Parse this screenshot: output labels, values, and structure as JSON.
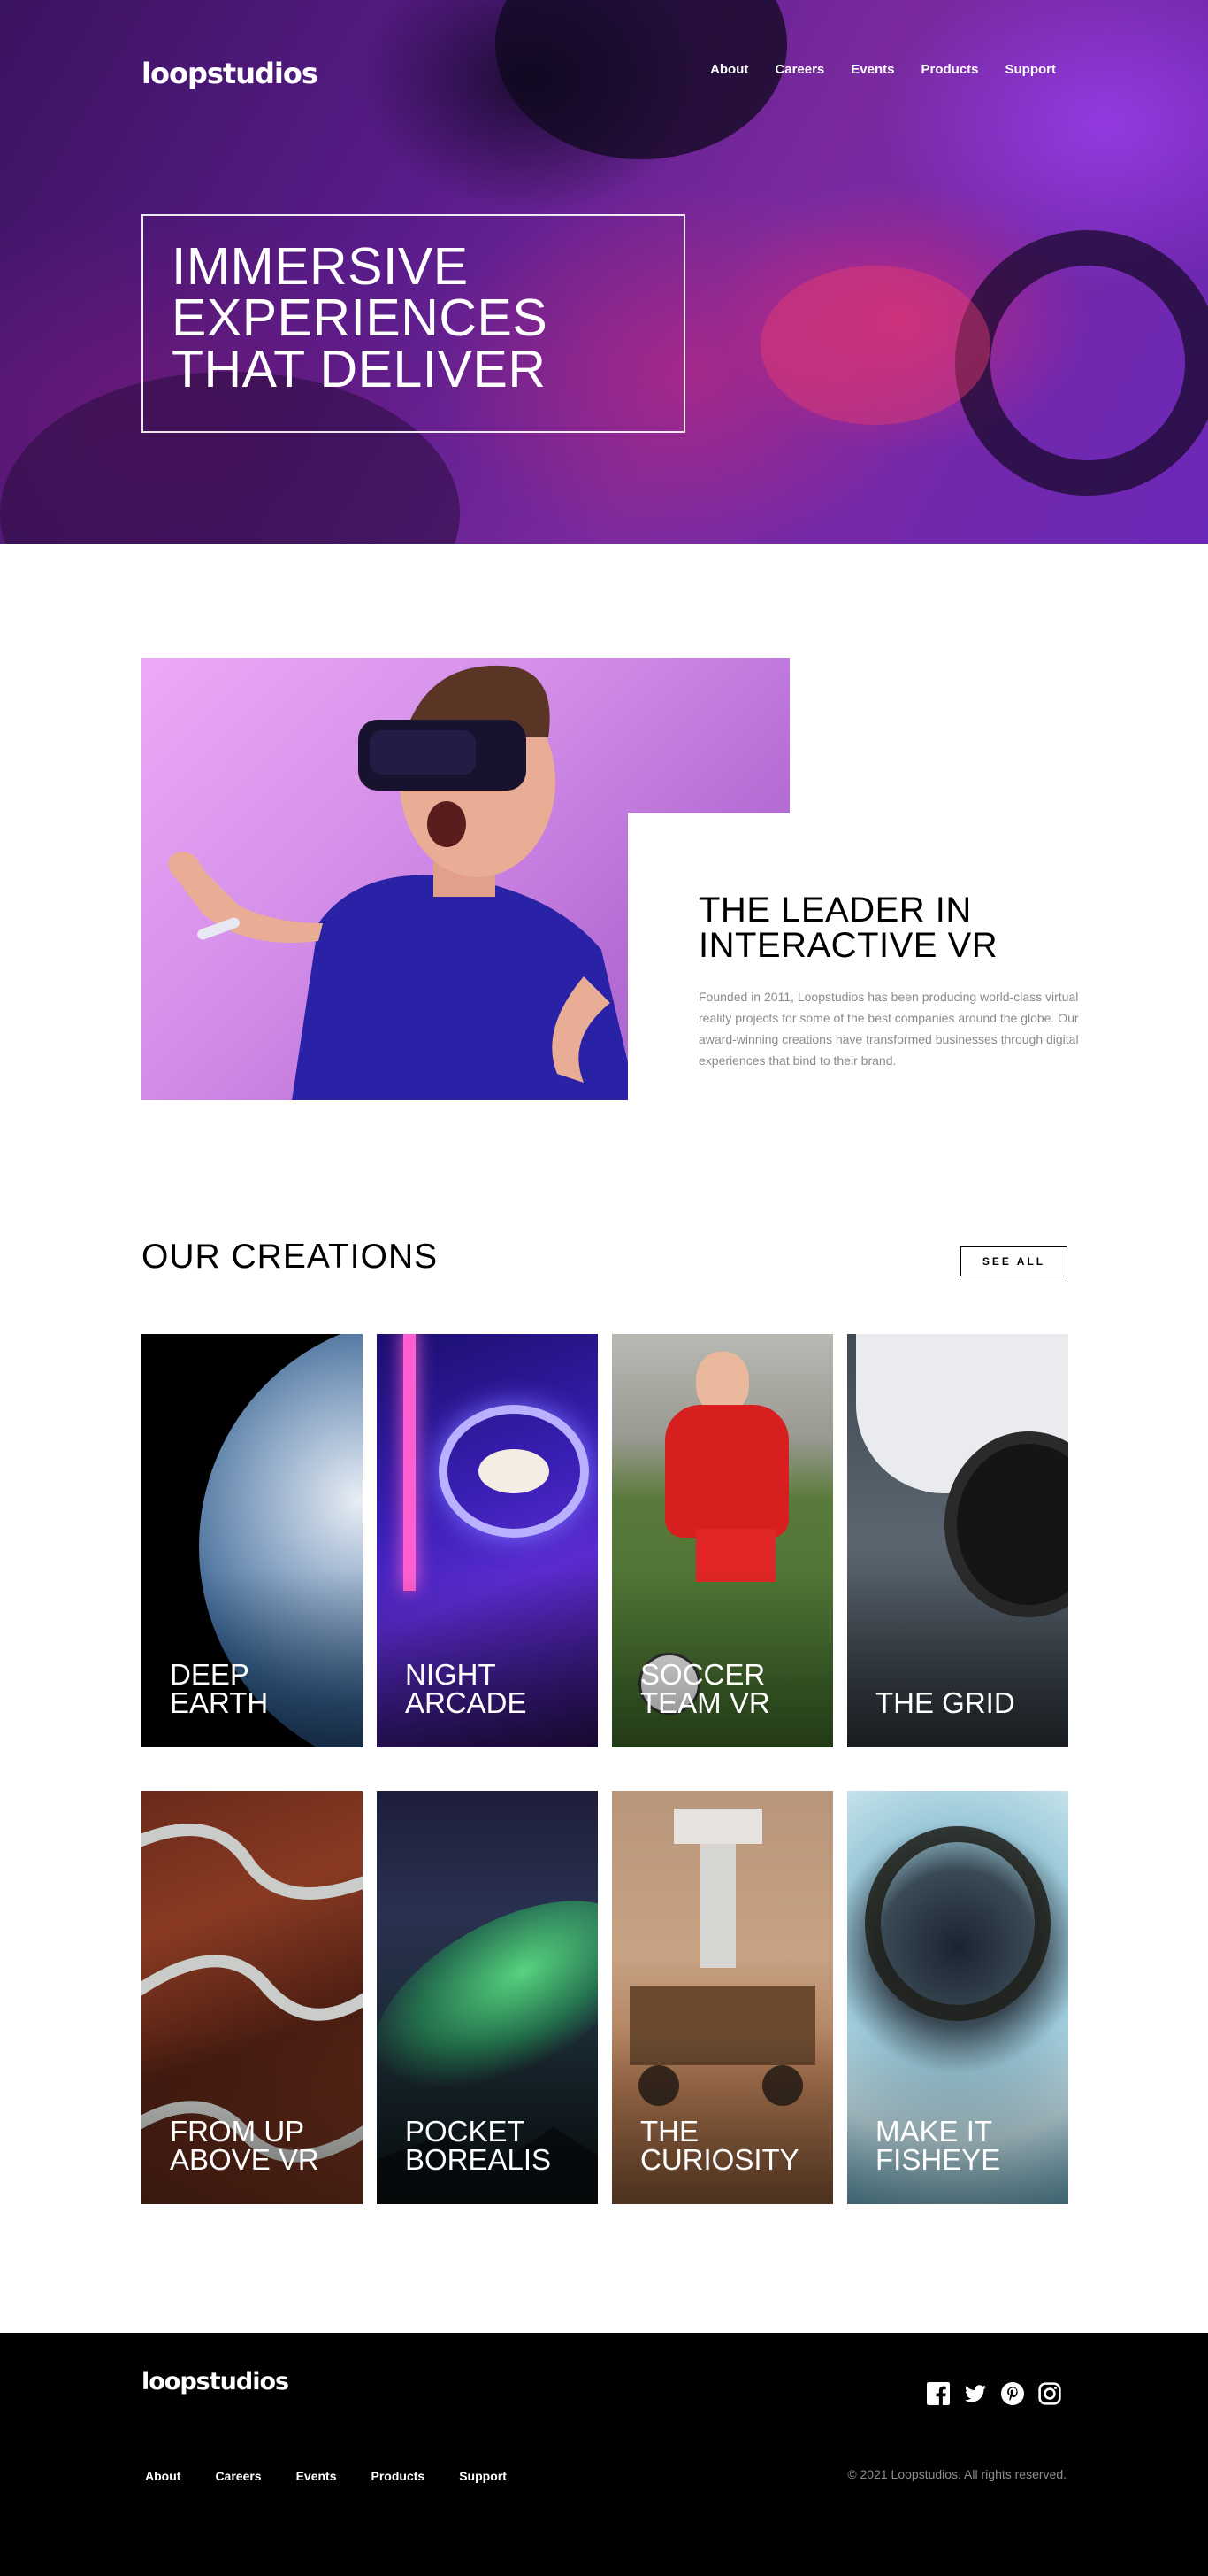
{
  "header": {
    "logo": "loopstudios",
    "nav": [
      "About",
      "Careers",
      "Events",
      "Products",
      "Support"
    ]
  },
  "hero": {
    "title_lines": [
      "IMMERSIVE",
      "EXPERIENCES",
      "THAT DELIVER"
    ]
  },
  "intro": {
    "title_lines": [
      "THE LEADER IN",
      "INTERACTIVE VR"
    ],
    "text": "Founded in 2011, Loopstudios has been producing world-class virtual reality projects for some of the best companies around the globe. Our award-winning creations have transformed businesses through digital experiences that bind to their brand."
  },
  "creations": {
    "title": "OUR CREATIONS",
    "see_all": "SEE ALL",
    "items": [
      {
        "lines": [
          "DEEP",
          "EARTH"
        ]
      },
      {
        "lines": [
          "NIGHT",
          "ARCADE"
        ]
      },
      {
        "lines": [
          "SOCCER",
          "TEAM VR"
        ]
      },
      {
        "lines": [
          "",
          "THE GRID"
        ]
      },
      {
        "lines": [
          "FROM UP",
          "ABOVE VR"
        ]
      },
      {
        "lines": [
          "POCKET",
          "BOREALIS"
        ]
      },
      {
        "lines": [
          "THE",
          "CURIOSITY"
        ]
      },
      {
        "lines": [
          "MAKE IT",
          "FISHEYE"
        ]
      }
    ]
  },
  "footer": {
    "logo": "loopstudios",
    "nav": [
      "About",
      "Careers",
      "Events",
      "Products",
      "Support"
    ],
    "copyright": "© 2021 Loopstudios. All rights reserved.",
    "socials": [
      "facebook-icon",
      "twitter-icon",
      "pinterest-icon",
      "instagram-icon"
    ]
  }
}
